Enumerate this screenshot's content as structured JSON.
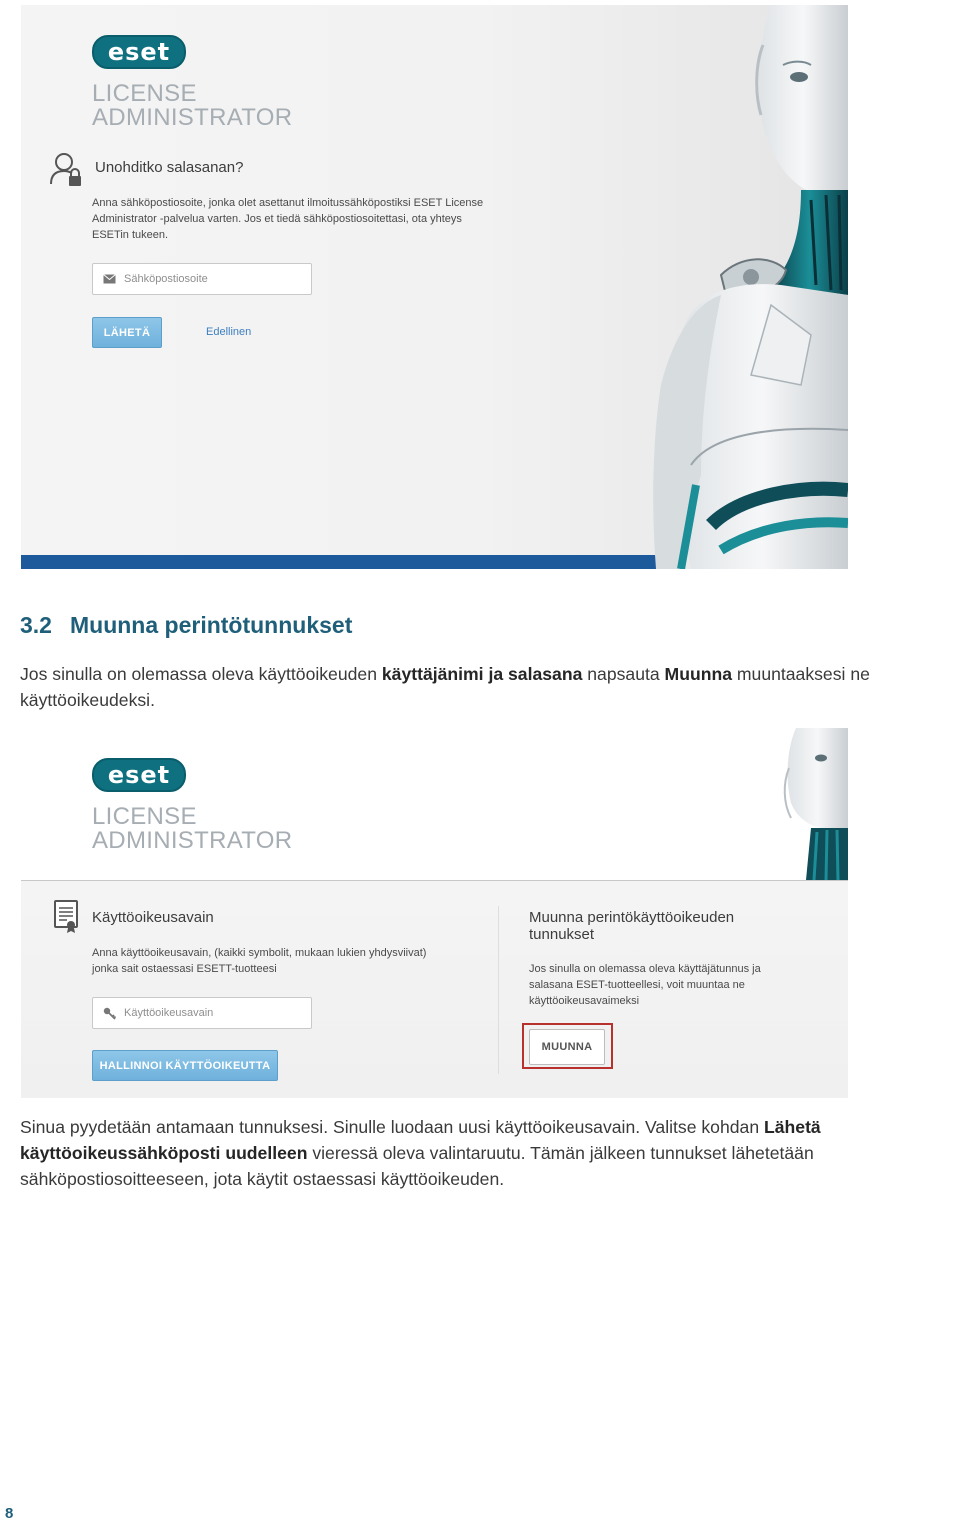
{
  "shot1": {
    "logo_text": "eset",
    "product_line1": "LICENSE",
    "product_line2": "ADMINISTRATOR",
    "title": "Unohditko salasanan?",
    "description_line1": "Anna sähköpostiosoite, jonka olet asettanut ilmoitussähköpostiksi ESET License",
    "description_line2": "Administrator -palvelua varten. Jos et tiedä sähköpostiosoitettasi, ota yhteys",
    "description_line3": "ESETin tukeen.",
    "email_placeholder": "Sähköpostiosoite",
    "send_button": "LÄHETÄ",
    "previous_link": "Edellinen"
  },
  "section": {
    "number": "3.2",
    "title": "Muunna perintötunnukset"
  },
  "intro": {
    "p1": "Jos sinulla on olemassa oleva käyttöoikeuden ",
    "b1": "käyttäjänimi ja salasana",
    "p2": " napsauta ",
    "b2": "Muunna",
    "p3": " muuntaaksesi ne käyttöoikeudeksi."
  },
  "shot2": {
    "logo_text": "eset",
    "product_line1": "LICENSE",
    "product_line2": "ADMINISTRATOR",
    "left_title": "Käyttöoikeusavain",
    "left_desc_line1": "Anna käyttöoikeusavain, (kaikki symbolit, mukaan lukien yhdysviivat)",
    "left_desc_line2": "jonka sait ostaessasi ESETT-tuotteesi",
    "key_placeholder": "Käyttöoikeusavain",
    "manage_button": "HALLINNOI KÄYTTÖOIKEUTTA",
    "right_title_line1": "Muunna perintökäyttöoikeuden",
    "right_title_line2": "tunnukset",
    "right_desc_line1": "Jos sinulla on olemassa oleva käyttäjätunnus ja",
    "right_desc_line2": "salasana ESET-tuotteellesi, voit muuntaa ne",
    "right_desc_line3": "käyttöoikeusavaimeksi",
    "convert_button": "MUUNNA"
  },
  "outro": {
    "p1": "Sinua pyydetään antamaan tunnuksesi. Sinulle luodaan uusi käyttöoikeusavain. Valitse kohdan ",
    "b1": "Lähetä käyttöoikeussähköposti uudelleen",
    "p2": " vieressä oleva valintaruutu. Tämän jälkeen tunnukset lähetetään sähköpostiosoitteeseen, jota käytit ostaessasi käyttöoikeuden."
  },
  "page_number": "8",
  "icons": {
    "user_lock": "user-lock-icon",
    "envelope": "envelope-icon",
    "certificate": "certificate-icon",
    "key": "key-icon",
    "robot": "eset-android-illustration"
  },
  "colors": {
    "eset_teal": "#0f7180",
    "heading_blue": "#1f5f7a",
    "button_blue": "#7bb9e1",
    "bar_blue": "#1d5a9c",
    "highlight_red": "#b8312f"
  }
}
